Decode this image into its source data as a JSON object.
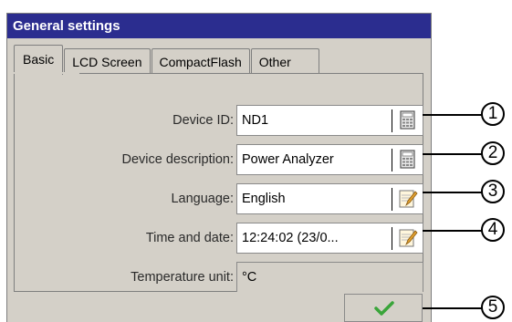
{
  "window": {
    "title": "General settings"
  },
  "tabs": [
    {
      "label": "Basic",
      "active": true
    },
    {
      "label": "LCD Screen",
      "active": false
    },
    {
      "label": "CompactFlash",
      "active": false
    },
    {
      "label": "Other",
      "active": false
    }
  ],
  "fields": [
    {
      "label": "Device ID:",
      "value": "ND1",
      "icon": "keypad-icon"
    },
    {
      "label": "Device description:",
      "value": "Power Analyzer",
      "icon": "keypad-icon"
    },
    {
      "label": "Language:",
      "value": "English",
      "icon": "edit-icon"
    },
    {
      "label": "Time and date:",
      "value": "12:24:02 (23/0...",
      "icon": "edit-icon"
    },
    {
      "label": "Temperature unit:",
      "value": "°C",
      "icon": ""
    }
  ],
  "footer": {
    "ok_icon": "checkmark-icon"
  },
  "callouts": [
    "1",
    "2",
    "3",
    "4",
    "5"
  ],
  "colors": {
    "titlebar": "#2b2d8f",
    "panel": "#d4d0c8",
    "check": "#3aa53a",
    "edit_icon": "#e0a030"
  }
}
